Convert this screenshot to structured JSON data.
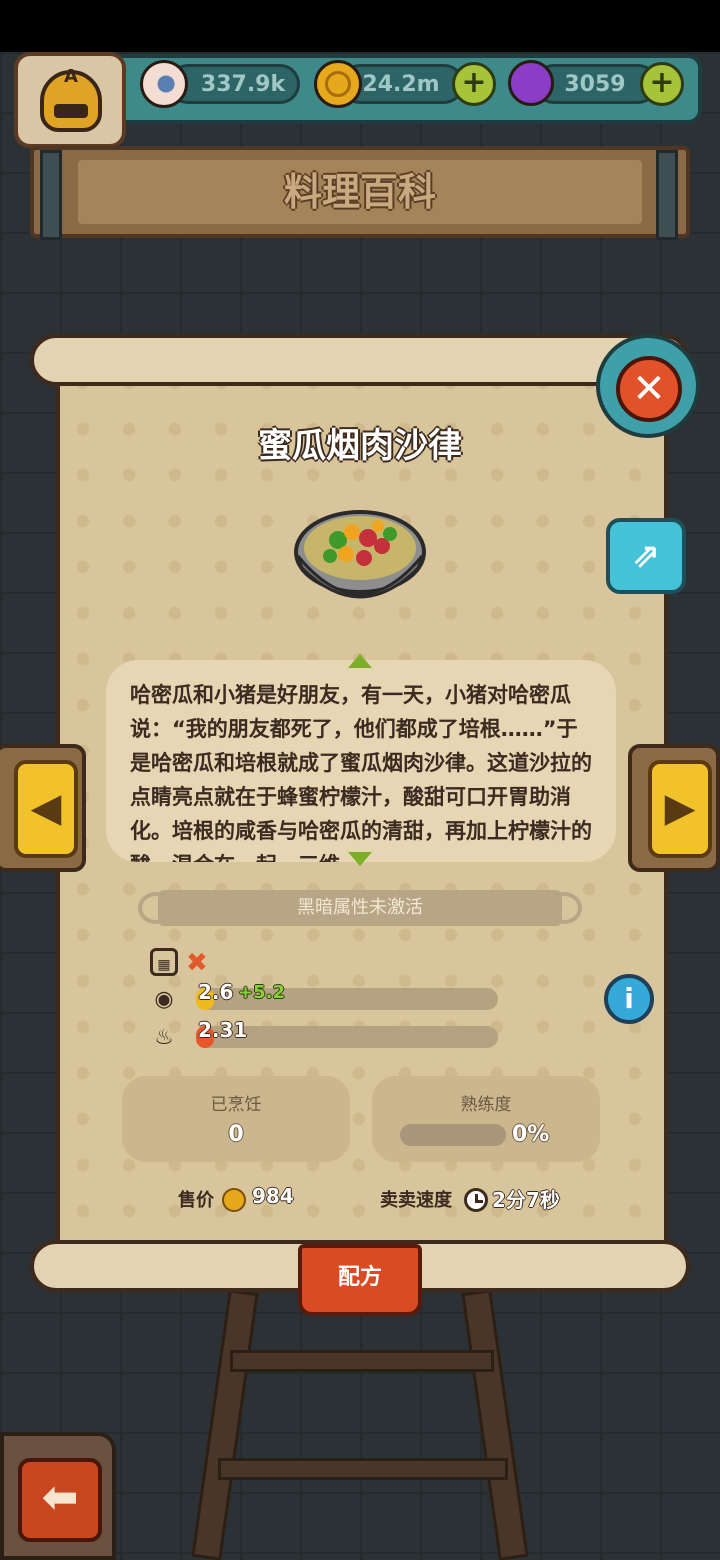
{
  "resources": {
    "eyes": "337.9k",
    "coins": "24.2m",
    "potions": "3059",
    "plus_label": "+",
    "avatar_letter": "A"
  },
  "header": {
    "title": "料理百科"
  },
  "dish": {
    "name": "蜜瓜烟肉沙律",
    "description": "哈密瓜和小猪是好朋友，有一天，小猪对哈密瓜说：“我的朋友都死了，他们都成了培根……”于是哈密瓜和培根就成了蜜瓜烟肉沙律。这道沙拉的点睛亮点就在于蜂蜜柠檬汁，酸甜可口开胃助消化。培根的咸香与哈密瓜的清甜，再加上柠檬汁的酸，混合在一起，三维"
  },
  "dark_attribute": {
    "text": "黑暗属性未激活"
  },
  "stats": {
    "sight_value": "2.6",
    "sight_bonus": "+5.2",
    "sight_fill": 0.06,
    "heat_value": "2.31",
    "heat_fill": 0.06
  },
  "cooked": {
    "label": "已烹饪",
    "value": "0"
  },
  "mastery": {
    "label": "熟练度",
    "value": "0%",
    "fill": 0
  },
  "sale": {
    "price_label": "售价",
    "price": "984",
    "speed_label": "卖卖速度",
    "speed": "2分7秒"
  },
  "buttons": {
    "recipe": "配方",
    "close": "✕",
    "share": "⇗",
    "info": "i",
    "prev": "◀",
    "next": "▶",
    "back": "⬅"
  },
  "icons": {
    "dark": "skull-block-icon",
    "sight": "eye-icon",
    "heat": "flame-icon"
  },
  "colors": {
    "scroll": "#d8c59b",
    "accent_green": "#8ad03a",
    "tab_red": "#d84b24",
    "arrow_yellow": "#f2c22a"
  }
}
